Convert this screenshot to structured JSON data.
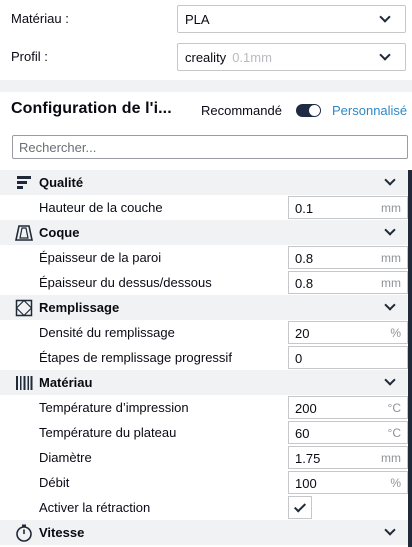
{
  "material_row": {
    "label": "Matériau :",
    "value": "PLA"
  },
  "profile_row": {
    "label": "Profil :",
    "value": "creality",
    "value_sub": "0.1mm"
  },
  "config": {
    "title": "Configuration de l'i...",
    "mode_recommended": "Recommandé",
    "mode_custom": "Personnalisé",
    "custom_enabled": true,
    "accent_color": "#2f88c6"
  },
  "search": {
    "placeholder": "Rechercher..."
  },
  "categories": [
    {
      "label": "Qualité",
      "icon": "layers-icon",
      "settings": [
        {
          "label": "Hauteur de la couche",
          "value": "0.1",
          "unit": "mm"
        }
      ]
    },
    {
      "label": "Coque",
      "icon": "shell-icon",
      "settings": [
        {
          "label": "Épaisseur de la paroi",
          "value": "0.8",
          "unit": "mm"
        },
        {
          "label": "Épaisseur du dessus/dessous",
          "value": "0.8",
          "unit": "mm"
        }
      ]
    },
    {
      "label": "Remplissage",
      "icon": "infill-icon",
      "settings": [
        {
          "label": "Densité du remplissage",
          "value": "20",
          "unit": "%"
        },
        {
          "label": "Étapes de remplissage progressif",
          "value": "0",
          "unit": ""
        }
      ]
    },
    {
      "label": "Matériau",
      "icon": "material-icon",
      "settings": [
        {
          "label": "Température d’impression",
          "value": "200",
          "unit": "°C"
        },
        {
          "label": "Température du plateau",
          "value": "60",
          "unit": "°C"
        },
        {
          "label": "Diamètre",
          "value": "1.75",
          "unit": "mm"
        },
        {
          "label": "Débit",
          "value": "100",
          "unit": "%"
        },
        {
          "label": "Activer la rétraction",
          "checked": true
        }
      ]
    },
    {
      "label": "Vitesse",
      "icon": "speed-icon",
      "settings": []
    }
  ]
}
